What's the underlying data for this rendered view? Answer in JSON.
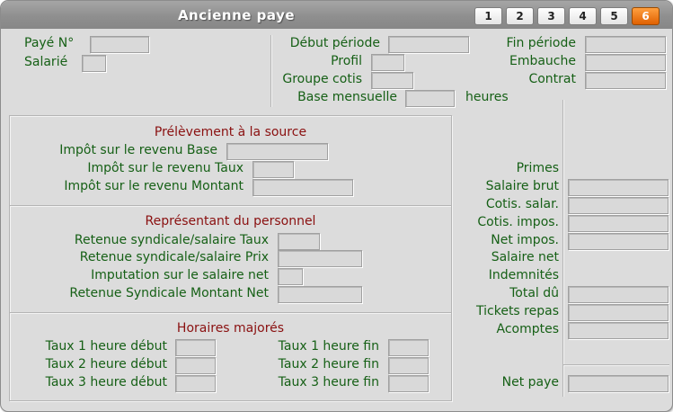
{
  "window": {
    "title": "Ancienne paye"
  },
  "tabs": [
    {
      "label": "1",
      "active": false
    },
    {
      "label": "2",
      "active": false
    },
    {
      "label": "3",
      "active": false
    },
    {
      "label": "4",
      "active": false
    },
    {
      "label": "5",
      "active": false
    },
    {
      "label": "6",
      "active": true
    }
  ],
  "header": {
    "paye_no": "Payé N°",
    "salarie": "Salarié",
    "debut_periode": "Début période",
    "profil": "Profil",
    "groupe_cotis": "Groupe cotis",
    "base_mensuelle": "Base mensuelle",
    "heures": "heures",
    "fin_periode": "Fin période",
    "embauche": "Embauche",
    "contrat": "Contrat"
  },
  "prelevement": {
    "title": "Prélèvement à la source",
    "base": "Impôt sur le revenu Base",
    "taux": "Impôt sur le revenu Taux",
    "montant": "Impôt sur le revenu Montant"
  },
  "representant": {
    "title": "Représentant du personnel",
    "taux": "Retenue syndicale/salaire Taux",
    "prix": "Retenue syndicale/salaire Prix",
    "imputation": "Imputation sur le salaire net",
    "montant_net": "Retenue Syndicale Montant Net"
  },
  "horaires": {
    "title": "Horaires majorés",
    "t1_debut": "Taux 1 heure début",
    "t2_debut": "Taux 2 heure début",
    "t3_debut": "Taux 3 heure début",
    "t1_fin": "Taux 1 heure fin",
    "t2_fin": "Taux 2 heure fin",
    "t3_fin": "Taux 3 heure fin"
  },
  "totaux": {
    "primes": "Primes",
    "salaire_brut": "Salaire brut",
    "cotis_salar": "Cotis. salar.",
    "cotis_impos": "Cotis. impos.",
    "net_impos": "Net impos.",
    "salaire_net": "Salaire net",
    "indemnites": "Indemnités",
    "total_du": "Total dû",
    "tickets_repas": "Tickets repas",
    "acomptes": "Acomptes",
    "net_paye": "Net paye"
  },
  "colors": {
    "label": "#166016",
    "section": "#8a1010",
    "active_tab": "#f07010"
  }
}
